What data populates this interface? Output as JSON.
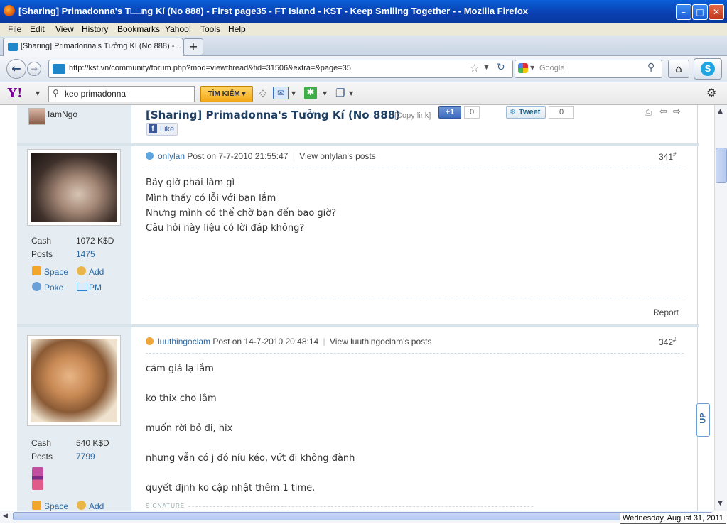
{
  "window": {
    "title": "[Sharing] Primadonna's T□□ng Kí (No 888) - First page35 - FT Island - KST - Keep Smiling Together - - Mozilla Firefox",
    "minimize": "–",
    "maximize": "□",
    "close": "✕"
  },
  "menu": [
    "File",
    "Edit",
    "View",
    "History",
    "Bookmarks",
    "Yahoo!",
    "Tools",
    "Help"
  ],
  "tab": {
    "label": "[Sharing] Primadonna's Tưởng Kí (No 888) - ...",
    "new_tab": "+"
  },
  "nav": {
    "url": "http://kst.vn/community/forum.php?mod=viewthread&tid=31506&extra=&page=35",
    "search_placeholder": "Google"
  },
  "yahoo": {
    "logo": "Y!",
    "search_value": "keo primadonna",
    "search_button": "TÌM KIẾM"
  },
  "thread": {
    "top_user": "IamNgo",
    "title": "[Sharing] Primadonna's Tưởng Kí (No 888)",
    "copy_link": "[Copy link]",
    "plus_one": "+1",
    "plus_count": "0",
    "tweet": "Tweet",
    "tweet_count": "0",
    "like": "Like"
  },
  "posts": [
    {
      "author": "onlylan",
      "posted": "Post on 7-7-2010 21:55:47",
      "view": "View onlylan's posts",
      "number": "341",
      "cash_label": "Cash",
      "cash": "1072 K$D",
      "posts_label": "Posts",
      "posts_count": "1475",
      "space": "Space",
      "add": "Add",
      "poke": "Poke",
      "pm": "PM",
      "lines": [
        "Bây giờ phải làm gì",
        "Mình thấy có lỗi với bạn lắm",
        "Nhưng mình có thể chờ bạn đến bao giờ?",
        "Câu hỏi này liệu có lời đáp không?"
      ],
      "report": "Report"
    },
    {
      "author": "luuthingoclam",
      "posted": "Post on 14-7-2010 20:48:14",
      "view": "View luuthingoclam's posts",
      "number": "342",
      "cash_label": "Cash",
      "cash": "540 K$D",
      "posts_label": "Posts",
      "posts_count": "7799",
      "space": "Space",
      "add": "Add",
      "lines": [
        "cảm giá lạ lắm",
        "ko thix cho lắm",
        "muốn rời bỏ đi, hix",
        "nhưng vẫn có j đó níu kéo, vứt đi không đành",
        "quyết định ko cập nhật thêm 1 time."
      ],
      "signature": "SIGNATURE"
    }
  ],
  "up_button": "UP",
  "status_date": "Wednesday, August 31, 2011",
  "colors": {
    "titlebar": "#0a4cc4",
    "link": "#2e6aa3",
    "sidebar": "#e5edf2"
  }
}
